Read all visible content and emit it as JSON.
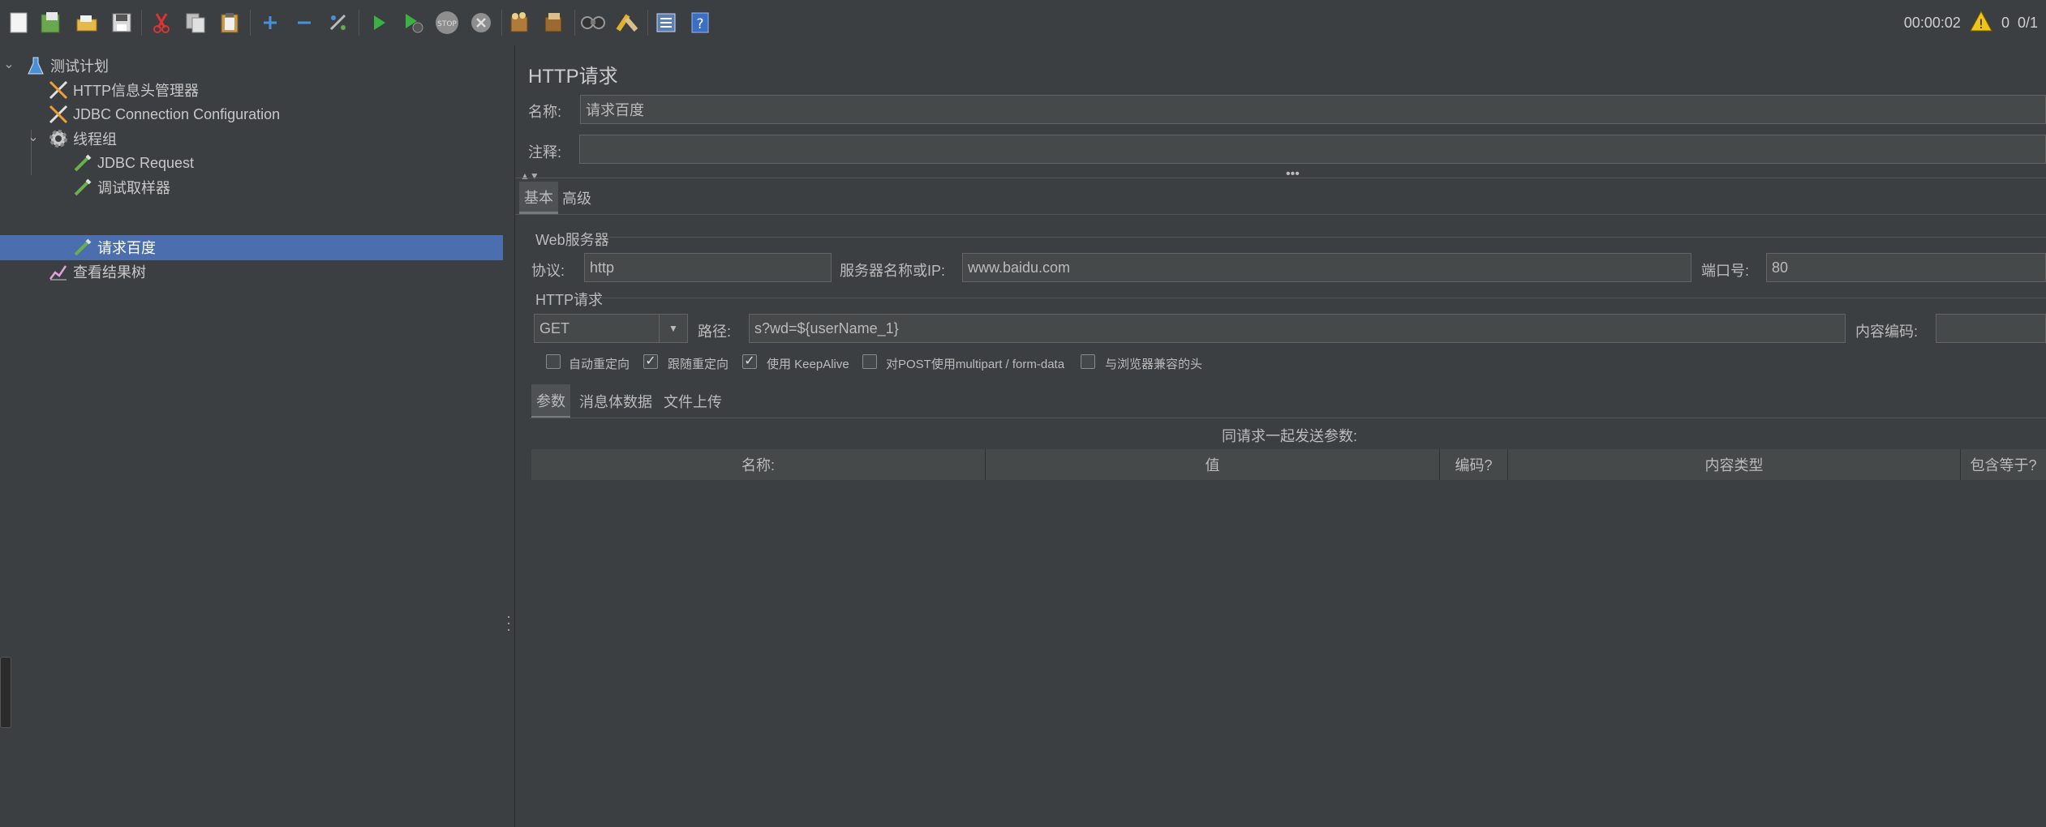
{
  "toolbar": {
    "timer": "00:00:02",
    "warning_count": "0",
    "threads": "0/1",
    "buttons": [
      "new-icon",
      "templates-icon",
      "open-icon",
      "save-icon",
      "cut-icon",
      "copy-icon",
      "paste-icon",
      "expand-icon",
      "collapse-icon",
      "toggle-icon",
      "start-icon",
      "start-no-pause-icon",
      "stop-icon",
      "shutdown-icon",
      "clear-icon",
      "clear-all-icon",
      "search-icon",
      "reset-search-icon",
      "function-helper-icon",
      "help-icon"
    ]
  },
  "tree": {
    "items": [
      {
        "label": "测试计划",
        "icon": "flask-icon"
      },
      {
        "label": "HTTP信息头管理器",
        "icon": "wrench-icon"
      },
      {
        "label": "JDBC Connection Configuration",
        "icon": "wrench-icon"
      },
      {
        "label": "线程组",
        "icon": "gear-icon"
      },
      {
        "label": "JDBC Request",
        "icon": "pipette-icon"
      },
      {
        "label": "调试取样器",
        "icon": "pipette-icon"
      },
      {
        "label": "请求百度",
        "icon": "pipette-icon"
      },
      {
        "label": "查看结果树",
        "icon": "chart-icon"
      }
    ]
  },
  "panel": {
    "title": "HTTP请求",
    "name_label": "名称:",
    "name_value": "请求百度",
    "comment_label": "注释:",
    "comment_value": "",
    "tabs": [
      "基本",
      "高级"
    ],
    "web_server": {
      "title": "Web服务器",
      "protocol_label": "协议:",
      "protocol_value": "http",
      "server_label": "服务器名称或IP:",
      "server_value": "www.baidu.com",
      "port_label": "端口号:",
      "port_value": "80"
    },
    "http_request": {
      "title": "HTTP请求",
      "method": "GET",
      "path_label": "路径:",
      "path_value": "s?wd=${userName_1}",
      "encoding_label": "内容编码:",
      "encoding_value": ""
    },
    "options": [
      {
        "label": "自动重定向",
        "checked": false
      },
      {
        "label": "跟随重定向",
        "checked": true
      },
      {
        "label": "使用 KeepAlive",
        "checked": true
      },
      {
        "label": "对POST使用multipart / form-data",
        "checked": false
      },
      {
        "label": "与浏览器兼容的头",
        "checked": false
      }
    ],
    "sub_tabs": [
      "参数",
      "消息体数据",
      "文件上传"
    ],
    "params_caption": "同请求一起发送参数:",
    "columns": [
      "名称:",
      "值",
      "编码?",
      "内容类型",
      "包含等于?"
    ]
  }
}
